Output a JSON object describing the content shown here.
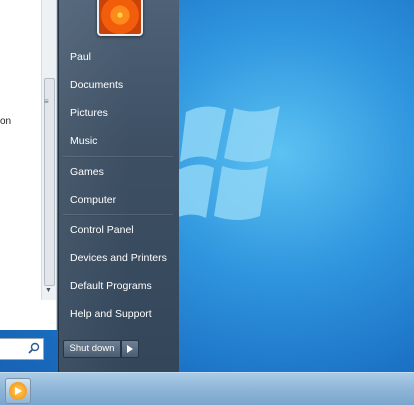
{
  "start_menu": {
    "user_name": "Paul",
    "items": [
      {
        "label": "Paul"
      },
      {
        "label": "Documents"
      },
      {
        "label": "Pictures"
      },
      {
        "label": "Music"
      },
      {
        "label": "Games"
      },
      {
        "label": "Computer"
      },
      {
        "label": "Control Panel"
      },
      {
        "label": "Devices and Printers"
      },
      {
        "label": "Default Programs"
      },
      {
        "label": "Help and Support"
      }
    ],
    "shutdown_label": "Shut down"
  },
  "left_pane": {
    "partial_text": "on",
    "search_placeholder": ""
  },
  "taskbar": {
    "pinned_icon": "media-player-icon"
  },
  "colors": {
    "menu_bg": "#3d4f63",
    "desktop_blue": "#2f95de",
    "taskbar": "#8fb6d8"
  }
}
